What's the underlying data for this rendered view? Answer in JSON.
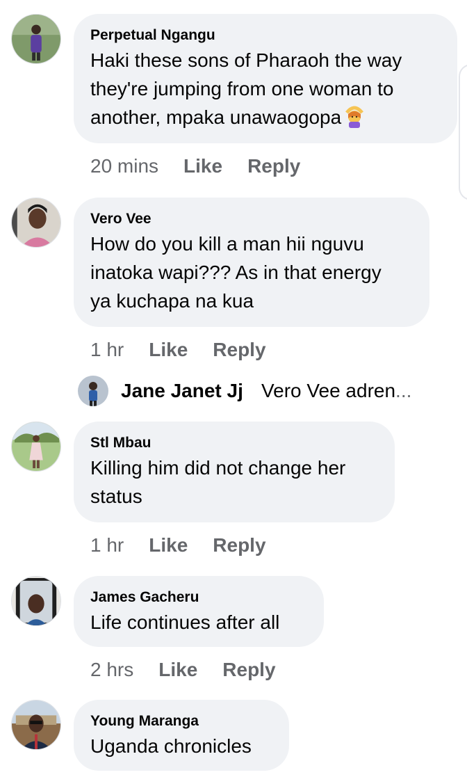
{
  "comments": [
    {
      "author": "Perpetual Ngangu",
      "lines": [
        "Haki these sons of Pharaoh the way",
        "they're jumping from one woman to",
        "another, mpaka unawaogopa"
      ],
      "emoji": "woman-gesturing-ok-emoji",
      "time": "20 mins",
      "like": "Like",
      "reply": "Reply"
    },
    {
      "author": "Vero Vee",
      "lines": [
        "How do you kill a man hii nguvu",
        "inatoka wapi??? As in that energy",
        "ya kuchapa na kua"
      ],
      "time": "1 hr",
      "like": "Like",
      "reply": "Reply"
    },
    {
      "author": "Stl Mbau",
      "lines": [
        "Killing him did not change her",
        "status"
      ],
      "time": "1 hr",
      "like": "Like",
      "reply": "Reply"
    },
    {
      "author": "James Gacheru",
      "lines": [
        "Life continues after all"
      ],
      "time": "2 hrs",
      "like": "Like",
      "reply": "Reply"
    },
    {
      "author": "Young Maranga",
      "lines": [
        "Uganda chronicles"
      ]
    }
  ],
  "reply_preview": {
    "author": "Jane Janet Jj",
    "text": "Vero Vee adren",
    "ellipsis": "..."
  }
}
